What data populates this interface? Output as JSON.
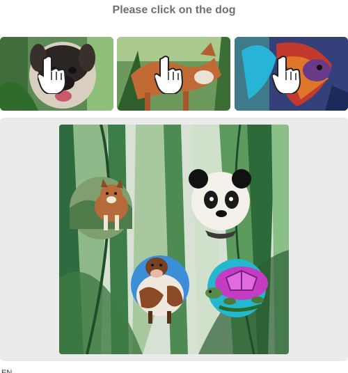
{
  "prompt": "Please click on the dog",
  "examples": [
    {
      "name": "example-dog"
    },
    {
      "name": "example-fox"
    },
    {
      "name": "example-bird"
    }
  ],
  "main_image": {
    "subjects": [
      "dog",
      "panda",
      "cow",
      "turtle"
    ]
  },
  "footer": {
    "language": "EN",
    "dots": [
      "#333333",
      "#1aa5a5"
    ]
  }
}
